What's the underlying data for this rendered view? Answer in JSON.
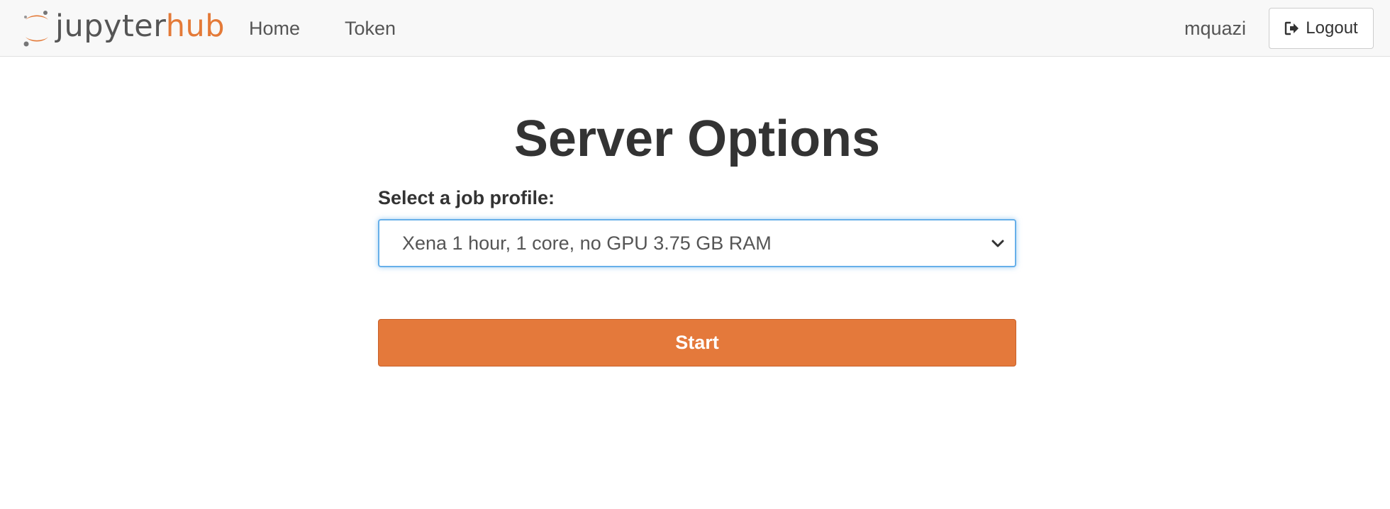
{
  "navbar": {
    "brand": {
      "part1": "jupyter",
      "part2": "hub",
      "logo_icon": "jupyter-logo-icon"
    },
    "links": [
      {
        "label": "Home"
      },
      {
        "label": "Token"
      }
    ],
    "username": "mquazi",
    "logout": {
      "label": "Logout",
      "icon": "sign-out-icon"
    }
  },
  "main": {
    "title": "Server Options",
    "profile_label": "Select a job profile:",
    "profile_selected": "Xena 1 hour, 1 core, no GPU 3.75 GB RAM",
    "start_label": "Start"
  },
  "colors": {
    "accent": "#e4793b",
    "navbar_bg": "#f8f8f8",
    "focus_border": "#66afe9",
    "text": "#333333"
  }
}
